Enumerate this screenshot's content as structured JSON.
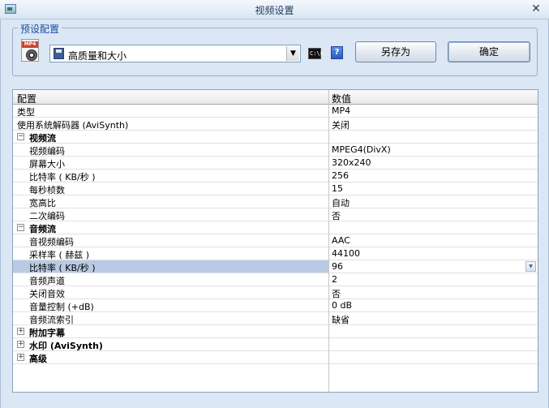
{
  "window": {
    "title": "视频设置",
    "close_glyph": "✕"
  },
  "preset": {
    "group_label": "预设配置",
    "selected": "高质量和大小",
    "file_icon_tag": "MP4",
    "cmd_icon_text": "C:\\>",
    "help_text": "?",
    "save_as_label": "另存为",
    "ok_label": "确定"
  },
  "grid": {
    "columns": {
      "name": "配置",
      "value": "数值"
    },
    "rows": [
      {
        "type": "item",
        "level": 0,
        "name": "类型",
        "value": "MP4"
      },
      {
        "type": "item",
        "level": 0,
        "name": "使用系统解码器 (AviSynth)",
        "value": "关闭"
      },
      {
        "type": "group",
        "expanded": true,
        "name": "视频流"
      },
      {
        "type": "item",
        "level": 1,
        "name": "视频编码",
        "value": "MPEG4(DivX)"
      },
      {
        "type": "item",
        "level": 1,
        "name": "屏幕大小",
        "value": "320x240"
      },
      {
        "type": "item",
        "level": 1,
        "name": "比特率 ( KB/秒 )",
        "value": "256"
      },
      {
        "type": "item",
        "level": 1,
        "name": "每秒桢数",
        "value": "15"
      },
      {
        "type": "item",
        "level": 1,
        "name": "宽高比",
        "value": "自动"
      },
      {
        "type": "item",
        "level": 1,
        "name": "二次编码",
        "value": "否"
      },
      {
        "type": "group",
        "expanded": true,
        "name": "音频流"
      },
      {
        "type": "item",
        "level": 1,
        "name": "音视频编码",
        "value": "AAC"
      },
      {
        "type": "item",
        "level": 1,
        "name": "采样率 ( 赫兹 )",
        "value": "44100"
      },
      {
        "type": "item",
        "level": 1,
        "name": "比特率 ( KB/秒 )",
        "value": "96",
        "selected": true
      },
      {
        "type": "item",
        "level": 1,
        "name": "音频声道",
        "value": "2"
      },
      {
        "type": "item",
        "level": 1,
        "name": "关闭音效",
        "value": "否"
      },
      {
        "type": "item",
        "level": 1,
        "name": "音量控制 (+dB)",
        "value": "0 dB"
      },
      {
        "type": "item",
        "level": 1,
        "name": "音频流索引",
        "value": "缺省"
      },
      {
        "type": "group",
        "expanded": false,
        "name": "附加字幕"
      },
      {
        "type": "group",
        "expanded": false,
        "name": "水印 (AviSynth)"
      },
      {
        "type": "group",
        "expanded": false,
        "name": "高级"
      }
    ]
  }
}
